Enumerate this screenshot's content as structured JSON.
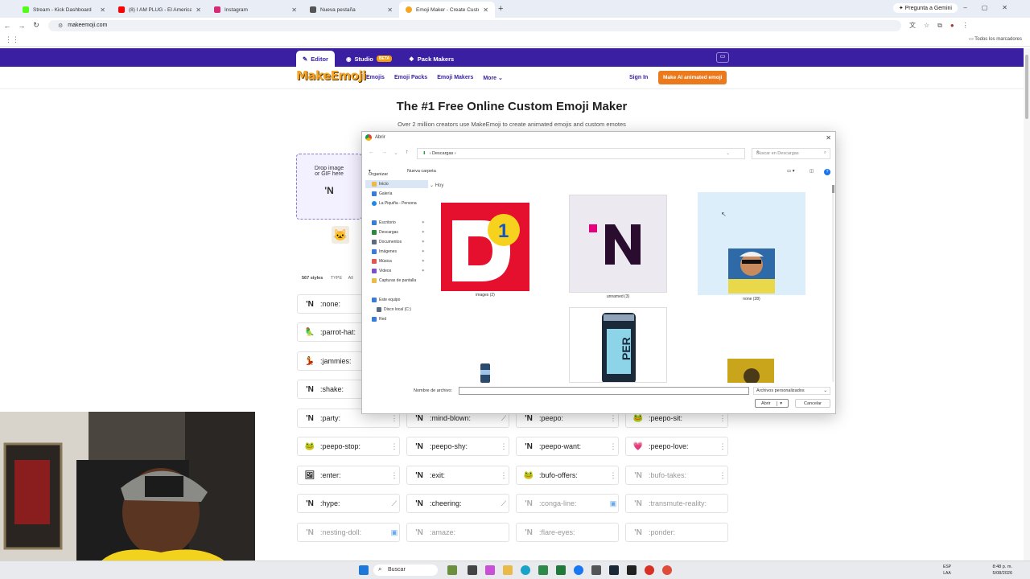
{
  "browser": {
    "tabs": [
      {
        "title": "Stream - Kick Dashboard",
        "color": "#53fc18"
      },
      {
        "title": "(8) I AM PLUG - El America...",
        "color": "#ff0000"
      },
      {
        "title": "Instagram",
        "color": "#d62976"
      },
      {
        "title": "Nueva pestaña",
        "color": "#555555"
      },
      {
        "title": "Emoji Maker - Create Custom E...",
        "color": "#f5a623"
      }
    ],
    "gemini_label": "Pregunta a Gemini",
    "url": "makeemoji.com",
    "bookmarks_all": "Todos los marcadores"
  },
  "site": {
    "top_tabs": {
      "editor": "Editor",
      "studio": "Studio",
      "studio_badge": "BETA",
      "pack_makers": "Pack Makers"
    },
    "logo": "MakeEmoji",
    "nav": [
      "Emojis",
      "Emoji Packs",
      "Emoji Makers",
      "More"
    ],
    "sign_in": "Sign In",
    "cta": "Make AI animated emoji",
    "hero_title": "The #1 Free Online Custom Emoji Maker",
    "hero_sub": "Over 2 million creators use MakeEmoji to create animated emojis and custom emotes",
    "dropzone": {
      "line1": "Drop image",
      "line2": "or GIF here",
      "mark": "'N"
    },
    "styles_count": "567 styles",
    "type_label": "TYPE",
    "type_value": "All",
    "accent": "#3b1fa3",
    "cta_color": "#ea7a1c"
  },
  "emoji_rows": [
    {
      "name": ":none:",
      "icon": "'N"
    },
    {
      "name": ":parrot-hat:",
      "icon": "🦜"
    },
    {
      "name": ":jammies:",
      "icon": "💃"
    },
    {
      "name": ":shake:",
      "icon": "'N"
    },
    {
      "name": ":party:",
      "icon": "'N"
    },
    {
      "name": ":mind-blown:",
      "icon": "'N"
    },
    {
      "name": ":peepo:",
      "icon": "'N"
    },
    {
      "name": ":peepo-sit:",
      "icon": "🐸"
    },
    {
      "name": ":peepo-stop:",
      "icon": "🐸"
    },
    {
      "name": ":peepo-shy:",
      "icon": "'N"
    },
    {
      "name": ":peepo-want:",
      "icon": "'N"
    },
    {
      "name": ":peepo-love:",
      "icon": "💗"
    },
    {
      "name": ":enter:",
      "icon": "🖼"
    },
    {
      "name": ":exit:",
      "icon": "'N"
    },
    {
      "name": ":bufo-offers:",
      "icon": "🐸"
    },
    {
      "name": ":bufo-takes:",
      "icon": "'N"
    },
    {
      "name": ":hype:",
      "icon": "'N"
    },
    {
      "name": ":cheering:",
      "icon": "'N"
    },
    {
      "name": ":conga-line:",
      "icon": "'N"
    },
    {
      "name": ":transmute-reality:",
      "icon": "'N"
    },
    {
      "name": ":nesting-doll:",
      "icon": "'N"
    },
    {
      "name": ":amaze:",
      "icon": "'N"
    },
    {
      "name": ":flare-eyes:",
      "icon": "'N"
    },
    {
      "name": ":ponder:",
      "icon": "'N"
    }
  ],
  "dialog": {
    "title": "Abrir",
    "breadcrumb": "Descargas",
    "search_placeholder": "Buscar en Descargas",
    "organize": "Organizar",
    "new_folder": "Nueva carpeta",
    "group_label": "Hoy",
    "sidebar": [
      {
        "label": "Inicio",
        "color": "#e9b949"
      },
      {
        "label": "Galería",
        "color": "#3a7bd5"
      },
      {
        "label": "La Piquiña - Persona",
        "color": "#1e88e5"
      },
      {
        "label": "Escritorio",
        "color": "#3a7bd5"
      },
      {
        "label": "Descargas",
        "color": "#2a8a3a"
      },
      {
        "label": "Documentos",
        "color": "#5b6b7a"
      },
      {
        "label": "Imágenes",
        "color": "#3a7bd5"
      },
      {
        "label": "Música",
        "color": "#e0574f"
      },
      {
        "label": "Videos",
        "color": "#7b4fc9"
      },
      {
        "label": "Capturas de pantalla",
        "color": "#e9b949"
      },
      {
        "label": "Este equipo",
        "color": "#3a7bd5"
      },
      {
        "label": "Disco local (C:)",
        "color": "#5b6b7a"
      },
      {
        "label": "Red",
        "color": "#3a7bd5"
      }
    ],
    "files": [
      {
        "label": "images (2)"
      },
      {
        "label": "unnamed (3)"
      },
      {
        "label": "none (28)"
      }
    ],
    "filename_label": "Nombre de archivo:",
    "filename_value": "",
    "filter": "Archivos personalizados",
    "open": "Abrir",
    "cancel": "Cancelar"
  },
  "taskbar": {
    "search": "Buscar",
    "lang1": "ESP",
    "lang2": "LAA",
    "time": "8:48 p. m.",
    "date": "5/08/2026"
  }
}
